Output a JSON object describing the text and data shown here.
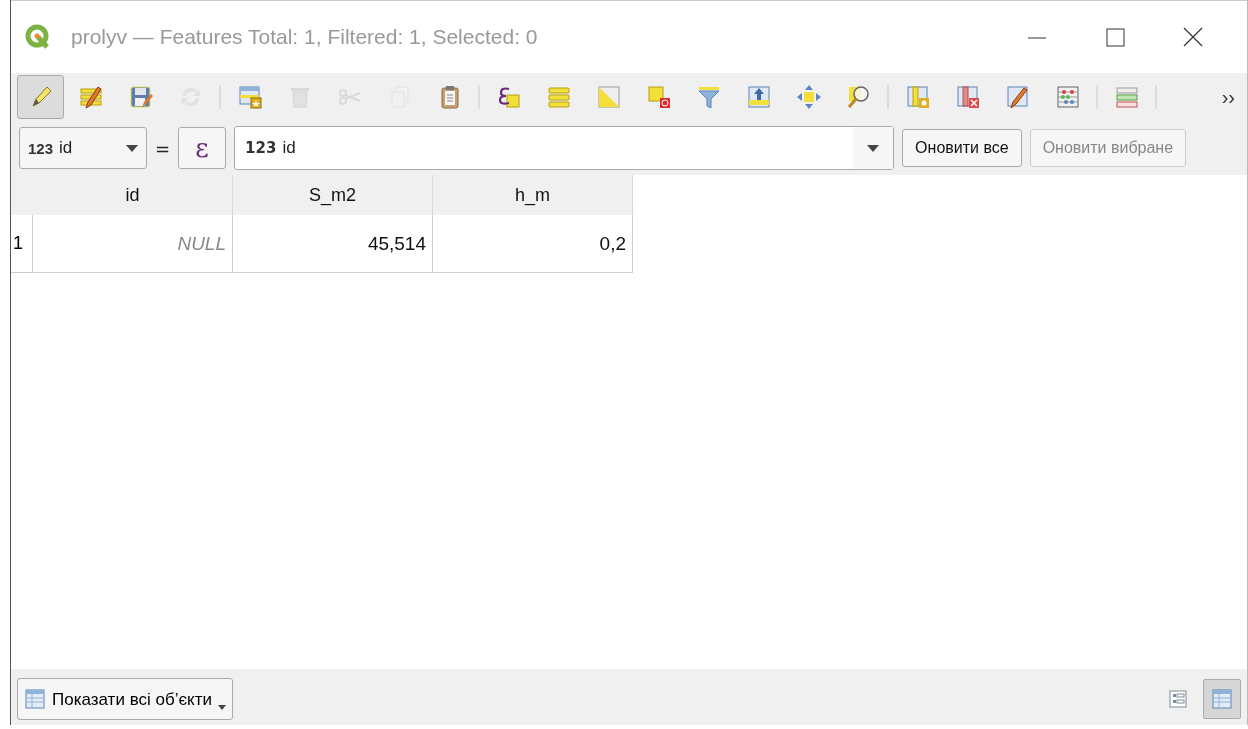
{
  "window": {
    "title": "prolyv — Features Total: 1, Filtered: 1, Selected: 0"
  },
  "toolbar": [
    {
      "kind": "button",
      "checked": true,
      "disabled": false
    },
    {
      "kind": "button",
      "checked": false,
      "disabled": false
    },
    {
      "kind": "button",
      "checked": false,
      "disabled": false
    },
    {
      "kind": "button",
      "checked": false,
      "disabled": true
    },
    {
      "kind": "separator"
    },
    {
      "kind": "button",
      "checked": false,
      "disabled": false
    },
    {
      "kind": "button",
      "checked": false,
      "disabled": true
    },
    {
      "kind": "button",
      "checked": false,
      "disabled": true
    },
    {
      "kind": "button",
      "checked": false,
      "disabled": true
    },
    {
      "kind": "button",
      "checked": false,
      "disabled": false
    },
    {
      "kind": "separator"
    },
    {
      "kind": "button",
      "checked": false,
      "disabled": false
    },
    {
      "kind": "button",
      "checked": false,
      "disabled": false
    },
    {
      "kind": "button",
      "checked": false,
      "disabled": false
    },
    {
      "kind": "button",
      "checked": false,
      "disabled": false
    },
    {
      "kind": "button",
      "checked": false,
      "disabled": false
    },
    {
      "kind": "button",
      "checked": false,
      "disabled": false
    },
    {
      "kind": "button",
      "checked": false,
      "disabled": false
    },
    {
      "kind": "button",
      "checked": false,
      "disabled": false
    },
    {
      "kind": "separator"
    },
    {
      "kind": "button",
      "checked": false,
      "disabled": false
    },
    {
      "kind": "button",
      "checked": false,
      "disabled": false
    },
    {
      "kind": "button",
      "checked": false,
      "disabled": false
    },
    {
      "kind": "button",
      "checked": false,
      "disabled": false
    },
    {
      "kind": "separator"
    },
    {
      "kind": "button",
      "checked": false,
      "disabled": false
    },
    {
      "kind": "separator"
    }
  ],
  "toolbar_overflow": "››",
  "filter": {
    "field_type": "123",
    "field": "id",
    "equals": "=",
    "expression_button": "ε",
    "value_type": "123",
    "value": "id",
    "update_all": {
      "label": "Оновити все",
      "disabled": false
    },
    "update_selected": {
      "label": "Оновити вибране",
      "disabled": true
    }
  },
  "table": {
    "columns": [
      "id",
      "S_m2",
      "h_m"
    ],
    "rows": [
      {
        "header": "1",
        "cells": [
          {
            "text": "NULL",
            "null": true
          },
          {
            "text": "45,514",
            "null": false
          },
          {
            "text": "0,2",
            "null": false
          }
        ]
      }
    ]
  },
  "bottom_bar": {
    "filter_button": "Показати всі об’єкти",
    "views": [
      {
        "kind": "form",
        "selected": false
      },
      {
        "kind": "table",
        "selected": true
      }
    ]
  }
}
